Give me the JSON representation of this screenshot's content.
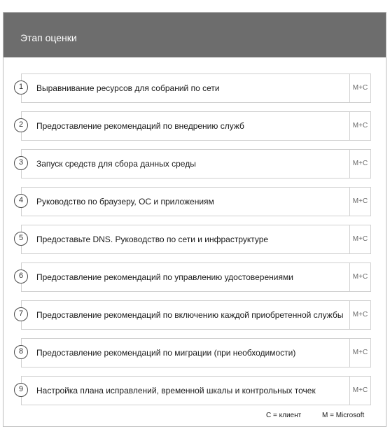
{
  "header": {
    "title": "Этап оценки"
  },
  "steps": [
    {
      "num": "1",
      "label": "Выравнивание ресурсов для собраний по сети",
      "owner": "M+C"
    },
    {
      "num": "2",
      "label": "Предоставление рекомендаций по внедрению служб",
      "owner": "M+C"
    },
    {
      "num": "3",
      "label": "Запуск средств для сбора данных среды",
      "owner": "M+C"
    },
    {
      "num": "4",
      "label": "Руководство по браузеру, ОС и приложениям",
      "owner": "M+C"
    },
    {
      "num": "5",
      "label": "Предоставьте DNS. Руководство по сети и инфраструктуре",
      "owner": "M+C"
    },
    {
      "num": "6",
      "label": "Предоставление рекомендаций по управлению удостоверениями",
      "owner": "M+C"
    },
    {
      "num": "7",
      "label": "Предоставление рекомендаций по включению каждой приобретенной службы",
      "owner": "M+C"
    },
    {
      "num": "8",
      "label": "Предоставление рекомендаций по миграции (при необходимости)",
      "owner": "M+C"
    },
    {
      "num": "9",
      "label": "Настройка плана исправлений, временной шкалы и контрольных точек",
      "owner": "M+C"
    }
  ],
  "legend": {
    "client": "C = клиент",
    "microsoft": "M = Microsoft"
  }
}
